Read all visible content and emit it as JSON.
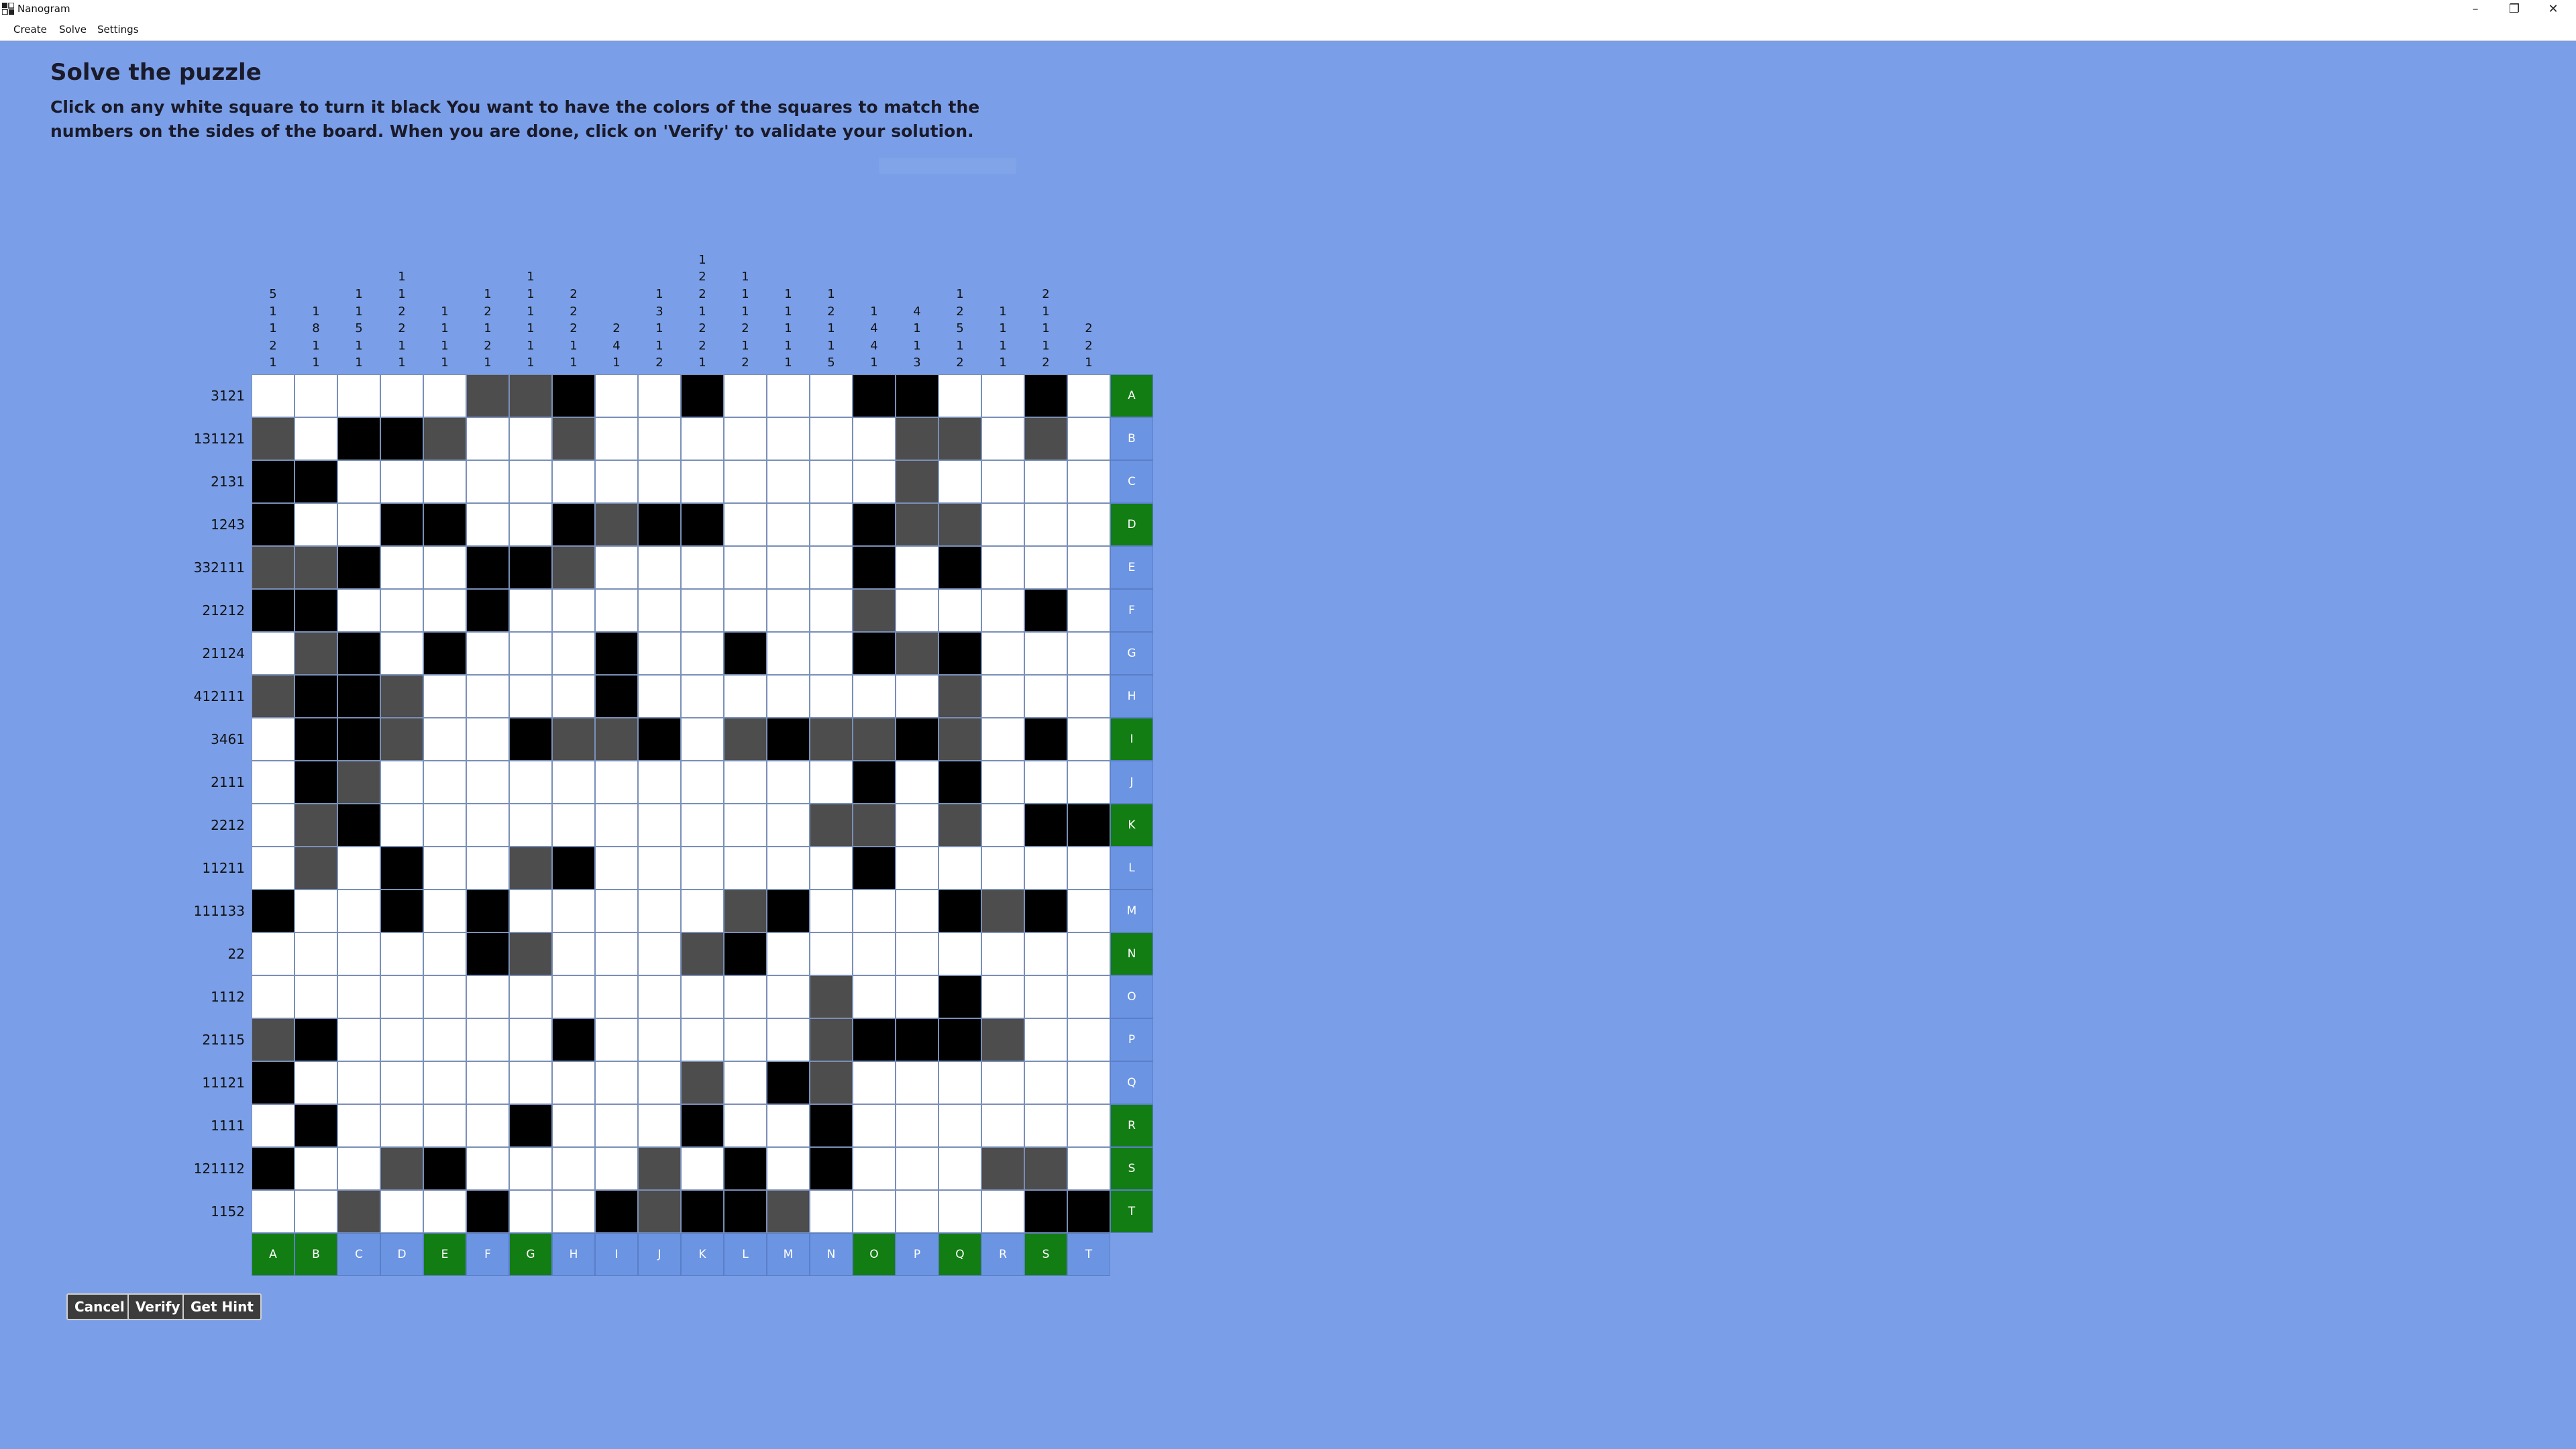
{
  "window": {
    "title": "Nanogram",
    "minimize_glyph": "–",
    "restore_glyph": "❐",
    "close_glyph": "✕"
  },
  "menu": {
    "items": [
      "Create",
      "Solve",
      "Settings"
    ]
  },
  "page": {
    "heading": "Solve the puzzle",
    "instructions": "Click on any white square to turn it black You want to have the colors of the squares to match the numbers on the sides of the board. When you are done, click on 'Verify' to validate your solution."
  },
  "buttons": {
    "cancel": "Cancel",
    "verify": "Verify",
    "hint": "Get Hint"
  },
  "colors": {
    "background": "#7a9fe8",
    "filled": "#000000",
    "marked": "#4d4d4d",
    "label_blue": "#6b94e3",
    "label_green": "#127d12"
  },
  "puzzle": {
    "col_letters": [
      "A",
      "B",
      "C",
      "D",
      "E",
      "F",
      "G",
      "H",
      "I",
      "J",
      "K",
      "L",
      "M",
      "N",
      "O",
      "P",
      "Q",
      "R",
      "S",
      "T"
    ],
    "row_letters": [
      "A",
      "B",
      "C",
      "D",
      "E",
      "F",
      "G",
      "H",
      "I",
      "J",
      "K",
      "L",
      "M",
      "N",
      "O",
      "P",
      "Q",
      "R",
      "S",
      "T"
    ],
    "col_label_states": [
      "green",
      "green",
      "blue",
      "blue",
      "green",
      "blue",
      "green",
      "blue",
      "blue",
      "blue",
      "blue",
      "blue",
      "blue",
      "blue",
      "green",
      "blue",
      "green",
      "blue",
      "green",
      "blue"
    ],
    "row_label_states": [
      "green",
      "blue",
      "blue",
      "green",
      "blue",
      "blue",
      "blue",
      "blue",
      "green",
      "blue",
      "green",
      "blue",
      "blue",
      "green",
      "blue",
      "blue",
      "blue",
      "green",
      "green",
      "green"
    ],
    "row_clues": [
      "3121",
      "131121",
      "2131",
      "1243",
      "332111",
      "21212",
      "21124",
      "412111",
      "3461",
      "2111",
      "2212",
      "11211",
      "111133",
      "22",
      "1112",
      "21115",
      "11121",
      "1111",
      "121112",
      "1152"
    ],
    "col_clues": [
      [
        "5",
        "1",
        "1",
        "2",
        "1"
      ],
      [
        "1",
        "8",
        "1",
        "1"
      ],
      [
        "1",
        "1",
        "5",
        "1",
        "1"
      ],
      [
        "1",
        "1",
        "2",
        "2",
        "1",
        "1"
      ],
      [
        "1",
        "1",
        "1",
        "1"
      ],
      [
        "1",
        "2",
        "1",
        "2",
        "1"
      ],
      [
        "1",
        "1",
        "1",
        "1",
        "1",
        "1"
      ],
      [
        "2",
        "2",
        "2",
        "1",
        "1"
      ],
      [
        "2",
        "4",
        "1"
      ],
      [
        "1",
        "3",
        "1",
        "1",
        "2"
      ],
      [
        "1",
        "2",
        "2",
        "1",
        "2",
        "2",
        "1"
      ],
      [
        "1",
        "1",
        "1",
        "2",
        "1",
        "2"
      ],
      [
        "1",
        "1",
        "1",
        "1",
        "1"
      ],
      [
        "1",
        "2",
        "1",
        "1",
        "5"
      ],
      [
        "1",
        "4",
        "4",
        "1"
      ],
      [
        "4",
        "1",
        "1",
        "3"
      ],
      [
        "1",
        "2",
        "5",
        "1",
        "2"
      ],
      [
        "1",
        "1",
        "1",
        "1"
      ],
      [
        "2",
        "1",
        "1",
        "1",
        "2"
      ],
      [
        "2",
        "2",
        "1"
      ]
    ],
    "grid": [
      "WWWWWGGBWWBWWWBBWWBW",
      "GWBBGWWGWWWWWWWGGWGW",
      "BBWWWWWWWWWWWWWGWWWW",
      "BWWBBWWBGBBWWWBGGWWW",
      "GGBWWBBGWWWWWWBWBWWW",
      "BBWWWBWWWWWWWWGWWWBW",
      "WGBWBWWWBWWBWWBGBWWW",
      "GBBGWWWWBWWWWWWWGWWW",
      "WBBGWWBGGBWGBGGBGWBW",
      "WBGWWWWWWWWWWWBWBWWW",
      "WGBWWWWWWWWWWGGWGWBB",
      "WGWBWWGBWWWWWWBWWWWW",
      "BWWBWBWWWWWGBWWWBGBW",
      "WWWWWBGWWWGBWWWWWWWW",
      "WWWWWWWWWWWWWGWWBWWW",
      "GBWWWWWBWWWWWGBBBGWW",
      "BWWWWWWWWWGWBGWWWWWW",
      "WBWWWWBWWWBWWBWWWWWW",
      "BWWGBWWWWGWBWBWWWGGW",
      "WWGWWBWWBGBBGWWWWWBB"
    ]
  }
}
